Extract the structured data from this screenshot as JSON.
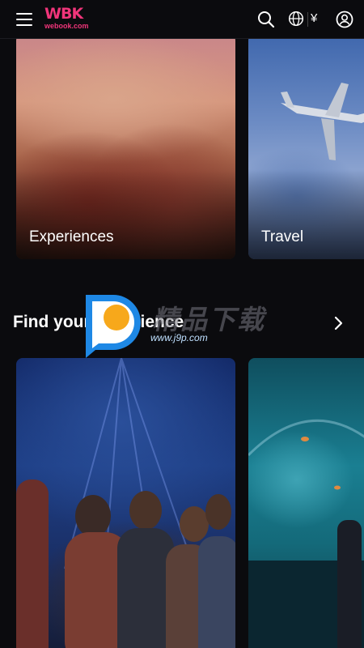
{
  "header": {
    "logo_mark": "WBK",
    "logo_sub": "webook.com",
    "currency": "¥",
    "icons": [
      "menu-icon",
      "search-icon",
      "globe-icon",
      "user-icon"
    ]
  },
  "categories": [
    {
      "label": "Experiences"
    },
    {
      "label": "Travel"
    }
  ],
  "find_section": {
    "title": "Find your experience",
    "cards": [
      {
        "label": ""
      },
      {
        "label": ""
      }
    ]
  },
  "watermark": {
    "text": "精品下载",
    "url": "www.j9p.com"
  },
  "colors": {
    "background": "#0b0b0e",
    "brand": "#f0357a",
    "text": "#ffffff"
  }
}
